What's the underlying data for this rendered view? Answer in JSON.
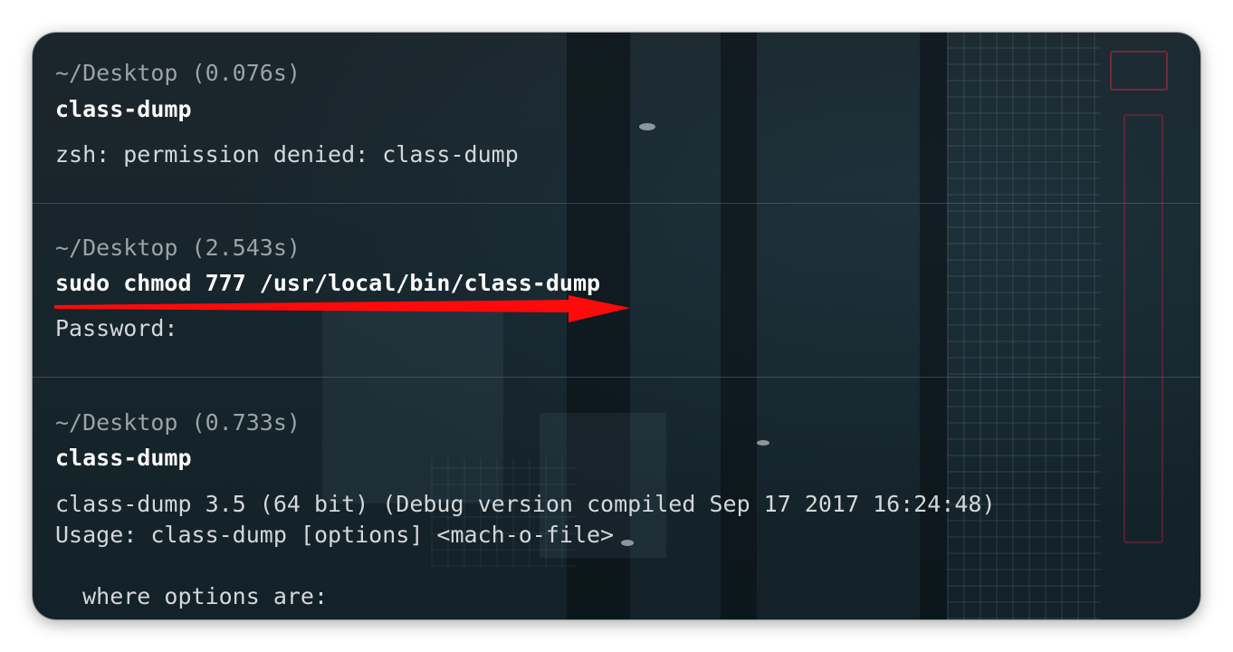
{
  "terminal": {
    "blocks": [
      {
        "prompt": "~/Desktop (0.076s)",
        "command": "class-dump",
        "output": [
          "zsh: permission denied: class-dump"
        ]
      },
      {
        "prompt": "~/Desktop (2.543s)",
        "command": "sudo chmod 777 /usr/local/bin/class-dump",
        "output": [
          "Password:"
        ]
      },
      {
        "prompt": "~/Desktop (0.733s)",
        "command": "class-dump",
        "output": [
          "class-dump 3.5 (64 bit) (Debug version compiled Sep 17 2017 16:24:48)",
          "Usage: class-dump [options] <mach-o-file>",
          "",
          "  where options are:"
        ]
      }
    ]
  },
  "annotation": {
    "arrow_color": "#ff0a0a",
    "arrow_icon": "red-arrow-right"
  },
  "colors": {
    "background": "#17252c",
    "prompt_text": "#9aa3a7",
    "command_text": "#ffffff",
    "output_text": "#d3d7d9"
  }
}
